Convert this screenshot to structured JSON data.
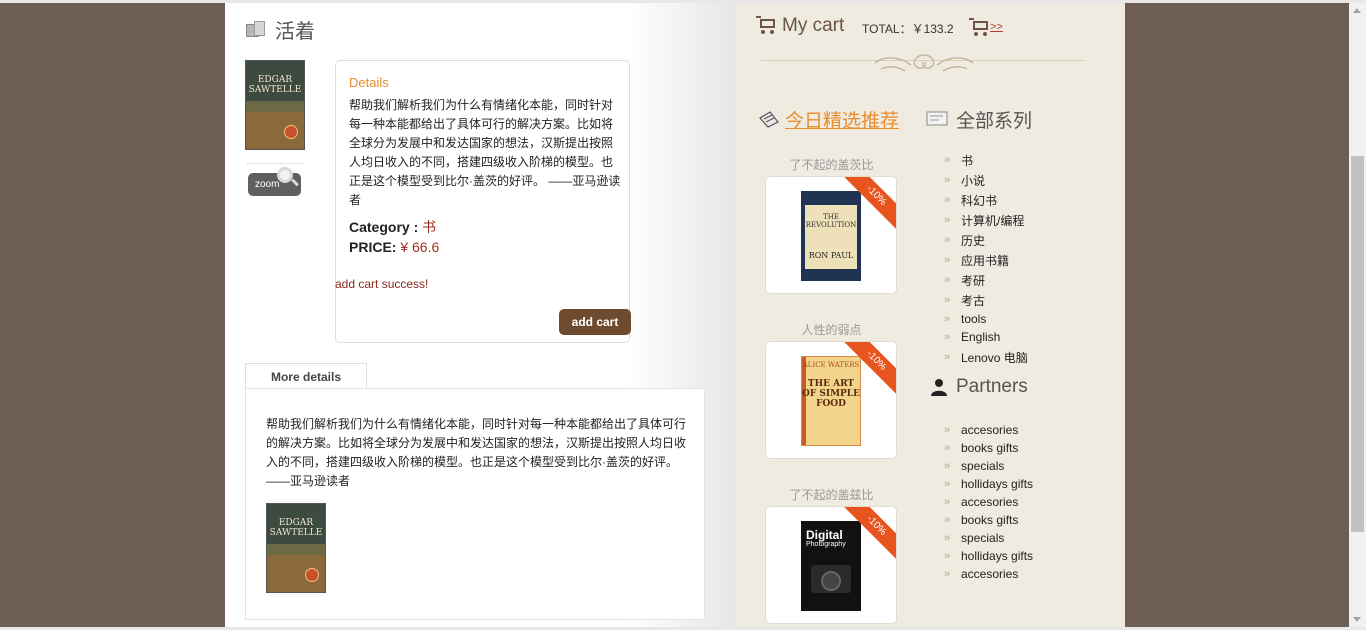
{
  "product": {
    "title": "活着",
    "zoom_label": "zoom",
    "details_label": "Details",
    "description": "帮助我们解析我们为什么有情绪化本能，同时针对每一种本能都给出了具体可行的解决方案。比如将全球分为发展中和发达国家的想法，汉斯提出按照人均日收入的不同，搭建四级收入阶梯的模型。也正是这个模型受到比尔·盖茨的好评。 ——亚马逊读者",
    "category_label": "Category :",
    "category_value": "书",
    "price_label": "PRICE:",
    "price_value": "¥ 66.6",
    "success_message": "add cart success!",
    "add_cart_label": "add cart",
    "cover_title": "EDGAR SAWTELLE",
    "more_details_tab": "More details",
    "more_description": "帮助我们解析我们为什么有情绪化本能，同时针对每一种本能都给出了具体可行的解决方案。比如将全球分为发展中和发达国家的想法，汉斯提出按照人均日收入的不同，搭建四级收入阶梯的模型。也正是这个模型受到比尔·盖茨的好评。 ——亚马逊读者"
  },
  "cart": {
    "title": "My cart",
    "total_text": "TOTAL：￥133.2",
    "link_text": ">>"
  },
  "recommend": {
    "title": "今日精选推荐",
    "items": [
      {
        "label": "了不起的盖茨比",
        "discount": "-10%",
        "cover_line1": "THE REVOLUTION",
        "cover_line2": "RON PAUL"
      },
      {
        "label": "人性的弱点",
        "discount": "-10%",
        "cover_line1": "ALICE WATERS",
        "cover_line2": "THE ART OF SIMPLE FOOD"
      },
      {
        "label": "了不起的盖兹比",
        "discount": "-10%",
        "cover_line1": "Digital",
        "cover_line2": "Photography"
      }
    ]
  },
  "series": {
    "title": "全部系列",
    "items": [
      "书",
      "小说",
      "科幻书",
      "计算机/编程",
      "历史",
      "应用书籍",
      "考研",
      "考古",
      "tools",
      "English",
      "Lenovo 电脑"
    ]
  },
  "partners": {
    "title": "Partners",
    "items": [
      "accesories",
      "books gifts",
      "specials",
      "hollidays gifts",
      "accesories",
      "books gifts",
      "specials",
      "hollidays gifts",
      "accesories"
    ]
  },
  "colors": {
    "background": "#6e5d55",
    "sidebar": "#f0ebe0",
    "accent_orange": "#e88d2c",
    "button_brown": "#6e4a2e",
    "price_red": "#a03020",
    "ribbon": "#e8541e"
  },
  "icons": {
    "title": "box-icon",
    "cart": "cart-icon",
    "recommend": "tag-icon",
    "series": "card-icon",
    "partners": "person-icon",
    "list_bullet": "double-chevron-icon"
  }
}
